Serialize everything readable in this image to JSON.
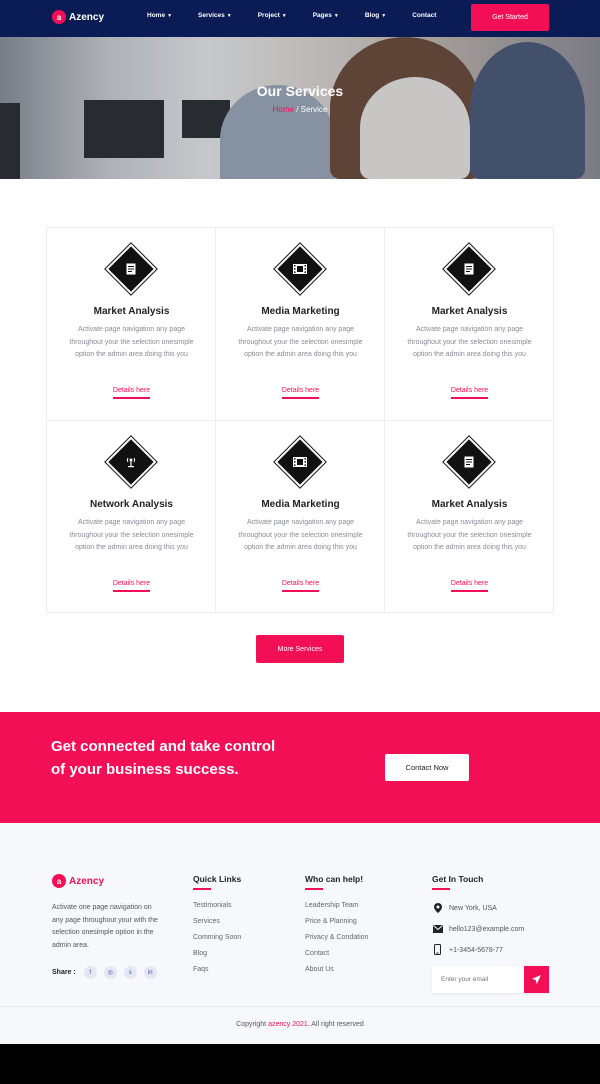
{
  "nav": {
    "logo_mark": "a",
    "logo_text": "Azency",
    "items": [
      {
        "label": "Home",
        "has_dropdown": true
      },
      {
        "label": "Services",
        "has_dropdown": true
      },
      {
        "label": "Project",
        "has_dropdown": true
      },
      {
        "label": "Pages",
        "has_dropdown": true
      },
      {
        "label": "Blog",
        "has_dropdown": true
      },
      {
        "label": "Contact",
        "has_dropdown": false
      }
    ],
    "cta": "Get Started"
  },
  "hero": {
    "title": "Our Services",
    "breadcrumb_home": "Home",
    "breadcrumb_sep": "/",
    "breadcrumb_current": "Service"
  },
  "services": [
    {
      "icon": "document-icon",
      "title": "Market Analysis",
      "desc": "Activate page navigation any page throughout your the selection onesimple option the admin area doing this you",
      "link": "Details here"
    },
    {
      "icon": "film-icon",
      "title": "Media Marketing",
      "desc": "Activate page navigation any page throughout your the selection onesimple option the admin area doing this you",
      "link": "Details here"
    },
    {
      "icon": "document-icon",
      "title": "Market Analysis",
      "desc": "Activate page navigation any page throughout your the selection onesimple option the admin area doing this you",
      "link": "Details here"
    },
    {
      "icon": "network-icon",
      "title": "Network Analysis",
      "desc": "Activate page navigation any page throughout your the selection onesimple option the admin area doing this you",
      "link": "Details here"
    },
    {
      "icon": "film-icon",
      "title": "Media Marketing",
      "desc": "Activate page navigation any page throughout your the selection onesimple option the admin area doing this you",
      "link": "Details here"
    },
    {
      "icon": "document-icon",
      "title": "Market Analysis",
      "desc": "Activate page navigation any page throughout your the selection onesimple option the admin area doing this you",
      "link": "Details here"
    }
  ],
  "more_services": "More Services",
  "cta": {
    "text": "Get connected and take control of your business success.",
    "button": "Contact Now"
  },
  "footer": {
    "logo_mark": "a",
    "logo_text": "Azency",
    "about": "Activate one page navigation on any page throughout your with the selection onesimple option in the admin area.",
    "share_label": "Share :",
    "socials": [
      "facebook-icon",
      "pinterest-icon",
      "skype-icon",
      "linkedin-icon"
    ],
    "quick_links": {
      "title": "Quick Links",
      "items": [
        "Testimonials",
        "Services",
        "Comming Soon",
        "Blog",
        "Faqs"
      ]
    },
    "who_can_help": {
      "title": "Who can help!",
      "items": [
        "Leadership Team",
        "Price & Planning",
        "Privacy & Condation",
        "Contact",
        "About Us"
      ]
    },
    "get_in_touch": {
      "title": "Get In Touch",
      "address": "New York, USA",
      "email": "hello123@example.com",
      "phone": "+1-3454-5678-77",
      "email_placeholder": "Enter your email"
    },
    "copyright_prefix": "Copyright",
    "copyright_brand": "azency 2021.",
    "copyright_suffix": "All right reserved"
  },
  "colors": {
    "navy": "#0a1b55",
    "accent": "#f30f56"
  }
}
